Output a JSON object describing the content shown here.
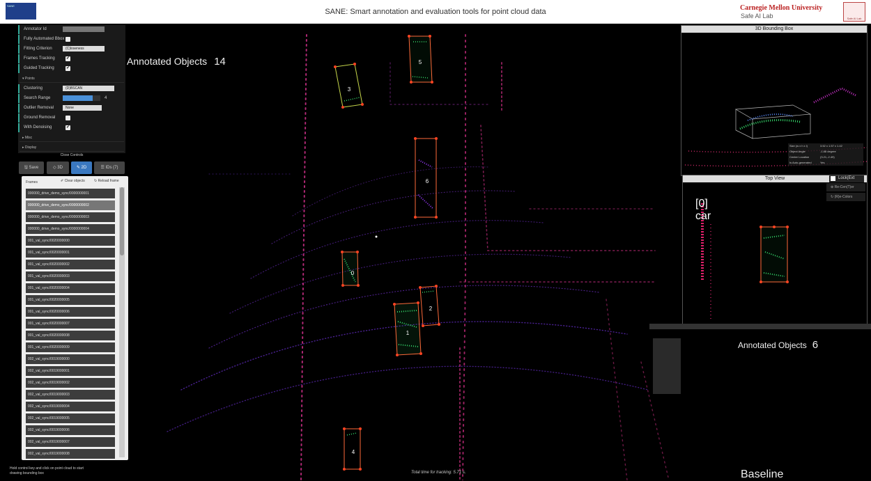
{
  "header": {
    "title": "SANE: Smart annotation and evaluation tools for point cloud data",
    "org": "Carnegie Mellon University",
    "lab": "Safe AI Lab",
    "crest_text": "Safe AI Lab"
  },
  "controls": {
    "annotator_id": "Annotator Id",
    "fully_automated": "Fully Automated Bbox",
    "fitting_criterion": "Fitting Criterion",
    "fitting_value": "(C)loseness",
    "frames_tracking": "Frames Tracking",
    "guided_tracking": "Guided Tracking",
    "points_folder": "Points",
    "clustering": "Clustering",
    "clustering_value": "(D)BSCAN",
    "search_range": "Search Range",
    "search_range_value": "4",
    "search_range_level": 0.8,
    "outlier_removal": "Outlier Removal",
    "outlier_value": "None",
    "ground_removal": "Ground Removal",
    "with_denoising": "With Denoising",
    "misc_folder": "Misc",
    "display_folder": "Display",
    "close_controls": "Close Controls",
    "check_mark": "✔"
  },
  "toolbar": {
    "save": "Save",
    "mode3d": "3D",
    "mode2d": "2D",
    "ids": "IDs (7)"
  },
  "frames": {
    "title": "Frames",
    "clear": "Clear objects",
    "reload": "Reload frame",
    "items": [
      "000000_drive_demo_sync/0000000001",
      "000000_drive_demo_sync/0000000002",
      "000000_drive_demo_sync/0000000003",
      "000000_drive_demo_sync/0000000004",
      "001_val_sync/0020000000",
      "001_val_sync/0020000001",
      "001_val_sync/0020000002",
      "001_val_sync/0020000003",
      "001_val_sync/0020000004",
      "001_val_sync/0020000005",
      "001_val_sync/0020000006",
      "001_val_sync/0020000007",
      "001_val_sync/0020000008",
      "001_val_sync/0020000009",
      "002_val_sync/0019000000",
      "002_val_sync/0019000001",
      "002_val_sync/0019000002",
      "002_val_sync/0019000003",
      "002_val_sync/0019000004",
      "002_val_sync/0019000005",
      "002_val_sync/0019000006",
      "002_val_sync/0019000007",
      "002_val_sync/0019000008"
    ],
    "selected_index": 1
  },
  "hint": "Hold control key and click on point cloud to start drawing bounding box",
  "tracking_time": "Total time for tracking: 5.71 s.",
  "annotated": {
    "label": "Annotated Objects",
    "count": "14"
  },
  "boxes": [
    "5",
    "3",
    "6",
    "0",
    "2",
    "1",
    "4"
  ],
  "bbox3d": {
    "title": "3D Bounding Box",
    "info": [
      {
        "k": "Size (w x h x l)",
        "v": "3.52 x 1.57 x 1.42"
      },
      {
        "k": "Object Angle",
        "v": "-1.88 degree"
      },
      {
        "k": "Center Location",
        "v": "(3.21,-2.49)"
      },
      {
        "k": "Is Auto-generated",
        "v": "Yes"
      }
    ]
  },
  "topview": {
    "title": "Top View",
    "lock": "Lock(Ext",
    "recenter": "Re-Cen(T)er",
    "recolors": "(R)e-Colors",
    "object_id": "[0]",
    "object_class": "car"
  },
  "baseline": {
    "annotated_label": "Annotated Objects",
    "annotated_count": "6",
    "label": "Baseline"
  },
  "colors": {
    "box_outline": "#ff6a3a",
    "box_corner": "#ff4422",
    "points_main": "#b03cff",
    "points_car": "#35d86a",
    "accent": "#3a78c0"
  }
}
